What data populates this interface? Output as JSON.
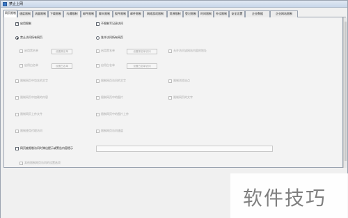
{
  "window": {
    "title": "禁止上网"
  },
  "tabs": [
    "网页限制",
    "速度限制",
    "流量限制",
    "下载限制",
    "内通限制",
    "邮件限制",
    "聊天限制",
    "股件限制",
    "邮件限制",
    "网络游戏限制",
    "资源限制",
    "登记限制",
    "时间限制",
    "外设限制",
    "安全设置",
    "企业数据",
    "企业网站限制"
  ],
  "options": {
    "enable_limit": "启用限制",
    "no_record": "不限制写记录访问",
    "forbid_all": "禁止访问所有网页",
    "allow_all_except": "准许访问所有网页",
    "blacklist": "启用黑名单",
    "whitelist": "启用白名单",
    "set_blacklist": "设置黑名单",
    "set_whitelist": "设置白名单",
    "url_blacklist": "启用黑名单",
    "url_whitelist": "启用白名单",
    "set_url_black": "设置黑名单访问",
    "set_url_white": "设置白名单访问",
    "allow_access_text": "允许访问该网站内容的地址",
    "r1c1": "限制网页中包含的文字",
    "r1c2": "限制网页访问的文字",
    "r1c3": "限制浏览站点",
    "r2c1": "限制网页中加载的内容",
    "r2c2": "限制网页中的图片",
    "r2c3": "限制网页的文字",
    "r3c1": "限制网页上传文件",
    "r3c2": "限制网页中的图片上传",
    "r4c1": "限制使用代理访问",
    "r4c2": "限制网页访问速度",
    "warn_label": "网页被限制访问时弹出提示或警告内容提示",
    "bottom_note": "其他限制网页访问的设置选项"
  },
  "watermark": "软件技巧"
}
